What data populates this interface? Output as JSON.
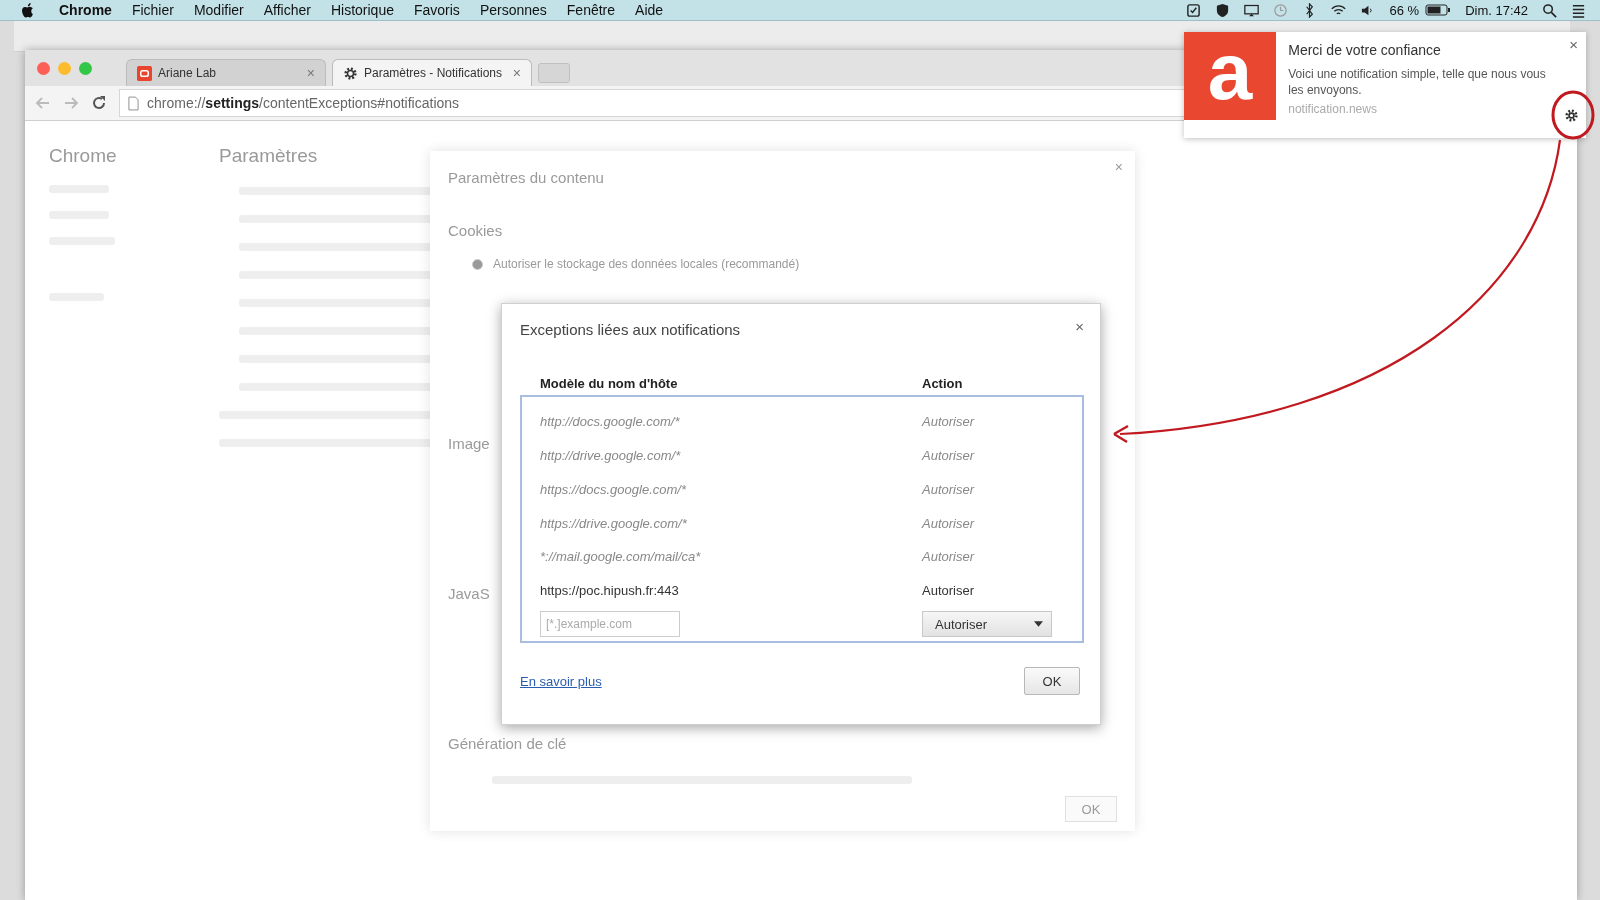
{
  "menu_bar": {
    "app": "Chrome",
    "items": [
      "Fichier",
      "Modifier",
      "Afficher",
      "Historique",
      "Favoris",
      "Personnes",
      "Fenêtre",
      "Aide"
    ],
    "battery": "66 %",
    "clock": "Dim. 17:42"
  },
  "browser": {
    "tabs": [
      {
        "title": "Ariane Lab",
        "selected": false,
        "kind": "site",
        "close": "×"
      },
      {
        "title": "Paramètres - Notifications",
        "selected": true,
        "kind": "settings",
        "close": "×"
      }
    ],
    "url": "chrome://**settings**/contentExceptions#notifications"
  },
  "settings_page": {
    "sidebar_title": "Chrome",
    "title": "Paramètres"
  },
  "content_settings": {
    "title": "Paramètres du contenu",
    "close": "×",
    "cookies_checked": true,
    "cookies_heading": "Cookies",
    "cookies_option": "Autoriser le stockage des données locales (recommandé)",
    "images_heading": "Image",
    "javascript_heading": "JavaS",
    "keygen_heading": "Génération de clé",
    "ok": "OK"
  },
  "dialog": {
    "title": "Exceptions liées aux notifications",
    "close": "×",
    "columns": [
      "Modèle du nom d'hôte",
      "Action"
    ],
    "rows": [
      {
        "pattern": "http://docs.google.com/*",
        "action": "Autoriser",
        "kind": "policy"
      },
      {
        "pattern": "http://drive.google.com/*",
        "action": "Autoriser",
        "kind": "policy"
      },
      {
        "pattern": "https://docs.google.com/*",
        "action": "Autoriser",
        "kind": "policy"
      },
      {
        "pattern": "https://drive.google.com/*",
        "action": "Autoriser",
        "kind": "policy"
      },
      {
        "pattern": "*://mail.google.com/mail/ca*",
        "action": "Autoriser",
        "kind": "policy"
      },
      {
        "pattern": "https://poc.hipush.fr:443",
        "action": "Autoriser",
        "kind": "user"
      }
    ],
    "new_pattern": {
      "placeholder": "[*.]example.com"
    },
    "new_action": "Autoriser",
    "link": "En savoir plus",
    "ok": "OK"
  },
  "notification": {
    "logo_letter": "a",
    "close": "×",
    "title": "Merci de votre confiance",
    "body": "Voici une notification simple, telle que nous vous les envoyons.",
    "source": "notification.news"
  }
}
